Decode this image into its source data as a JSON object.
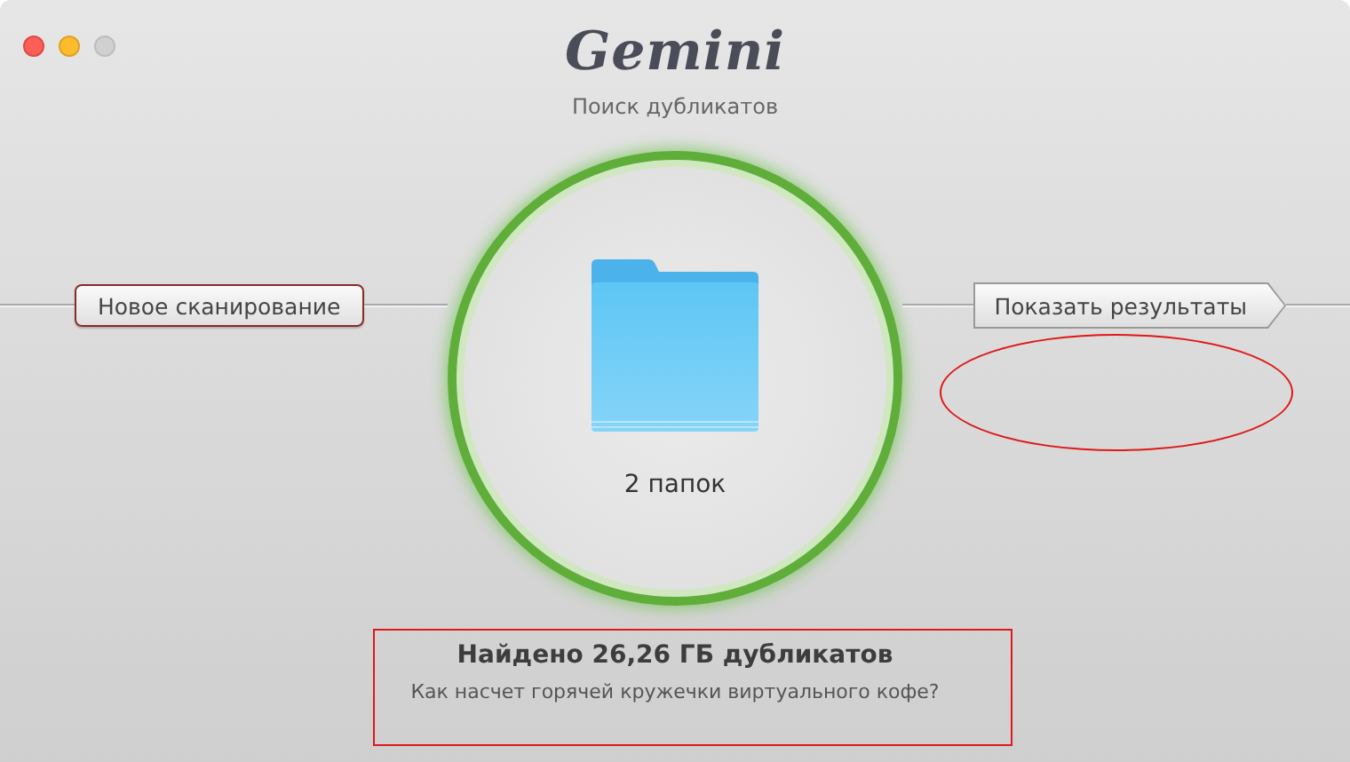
{
  "window": {
    "logo": "Gemini",
    "subtitle": "Поиск дубликатов"
  },
  "actions": {
    "left": {
      "label": "Новое сканирование"
    },
    "right": {
      "label": "Показать результаты"
    }
  },
  "scan": {
    "folders": "2 папок"
  },
  "result": {
    "title": "Найдено 26,26 ГБ дубликатов",
    "message": "Как насчет горячей кружечки виртуального кофе?"
  }
}
